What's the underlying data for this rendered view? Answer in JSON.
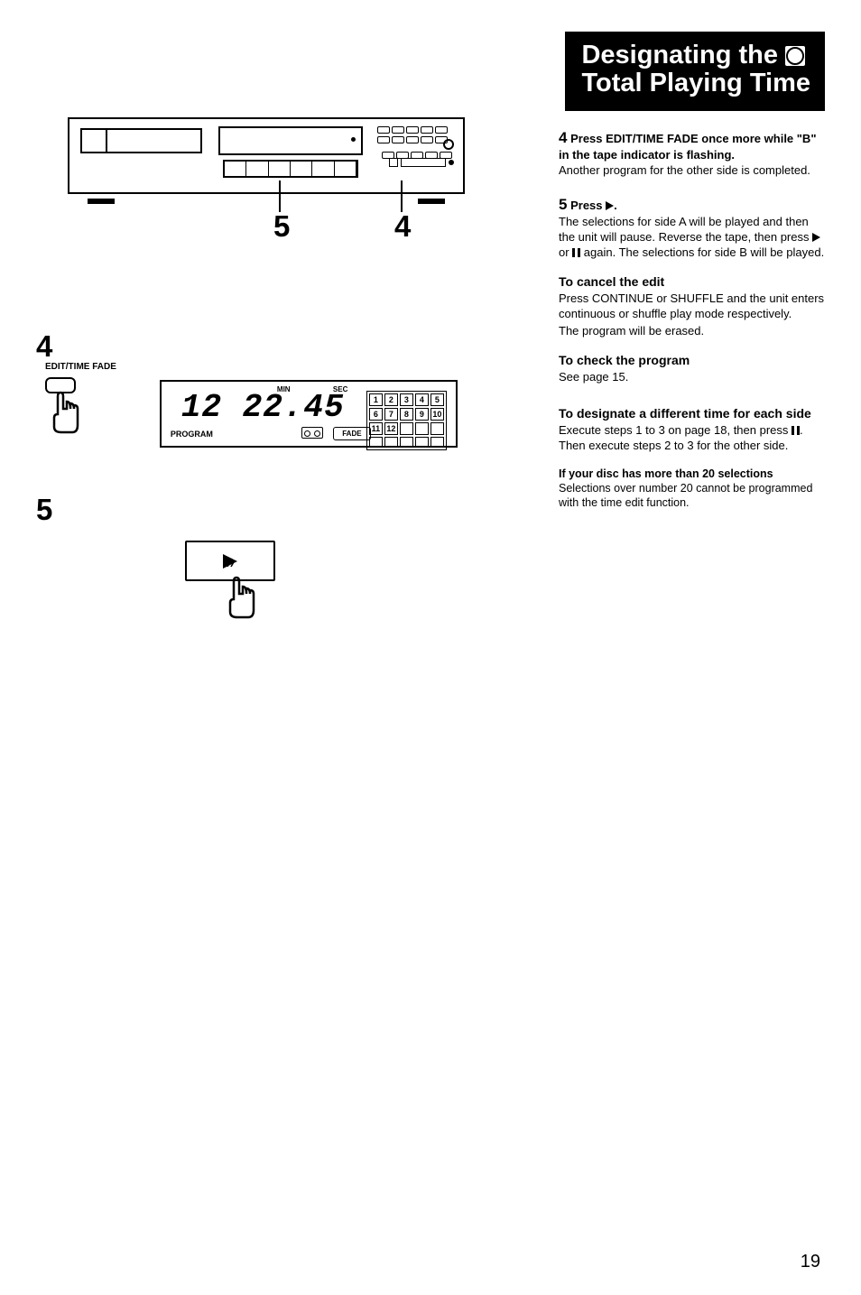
{
  "title": {
    "line1": "Designating the",
    "line2": "Total Playing Time"
  },
  "device_callouts": {
    "left": "5",
    "right": "4"
  },
  "step4_left": {
    "num": "4",
    "btn_label": "EDIT/TIME FADE",
    "display": {
      "track": "12",
      "time": "22.45",
      "min": "MIN",
      "sec": "SEC",
      "program": "PROGRAM",
      "fade": "FADE",
      "tracks": [
        "1",
        "2",
        "3",
        "4",
        "5",
        "6",
        "7",
        "8",
        "9",
        "10",
        "11",
        "12",
        "",
        "",
        "",
        "",
        "",
        "",
        "",
        ""
      ]
    }
  },
  "step5_left": {
    "num": "5"
  },
  "right": {
    "s4_num": "4",
    "s4_head": "Press EDIT/TIME FADE once more while \"B\" in the tape indicator is flashing.",
    "s4_body": "Another program for the other side is completed.",
    "s5_num": "5",
    "s5_head_pre": "Press ",
    "s5_head_post": ".",
    "s5_body_a": "The selections for side A will be played and then the unit will pause. Reverse the tape, then press ",
    "s5_body_b": " or ",
    "s5_body_c": " again. The selections for side B will be played.",
    "cancel_head": "To cancel the edit",
    "cancel_body1": "Press CONTINUE or SHUFFLE and the unit enters continuous or shuffle play mode respectively.",
    "cancel_body2": "The program will be erased.",
    "check_head": "To check the program",
    "check_body": "See page 15.",
    "diff_head": "To designate a different time for each side",
    "diff_body_a": "Execute steps 1 to 3 on page 18, then press ",
    "diff_body_b": ". Then execute steps 2 to 3 for the other side.",
    "note_head": "If your disc has more than 20 selections",
    "note_body": "Selections over number 20 cannot be programmed with the time edit function."
  },
  "page_num": "19"
}
